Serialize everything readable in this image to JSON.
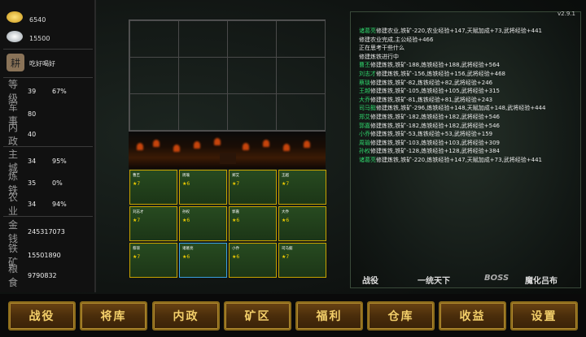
{
  "resources": {
    "gold": "6540",
    "silver": "15500"
  },
  "status": "吃好喝好",
  "stats": [
    {
      "key": "等级",
      "value": "39",
      "pct": "67%"
    },
    {
      "key": "军事",
      "value": "80",
      "pct": ""
    },
    {
      "key": "内政",
      "value": "40",
      "pct": ""
    },
    {
      "key": "主城",
      "value": "34",
      "pct": "95%"
    },
    {
      "key": "炼铁",
      "value": "35",
      "pct": "0%"
    },
    {
      "key": "农业",
      "value": "34",
      "pct": "94%"
    },
    {
      "key": "金钱",
      "value": "245317073",
      "pct": ""
    },
    {
      "key": "铁矿",
      "value": "15501890",
      "pct": ""
    },
    {
      "key": "粮食",
      "value": "9790832",
      "pct": ""
    }
  ],
  "version": "v2.9.1",
  "log": [
    {
      "name": "诸葛亮",
      "text": "修建农业,铁矿-220,农业经验+147,天赋加成+73,武将经验+441"
    },
    {
      "name": "",
      "text": "修建农业完成,主公经验+466"
    },
    {
      "name": "",
      "text": "正在思考干些什么"
    },
    {
      "name": "",
      "text": "修建炼铁进行中"
    },
    {
      "name": "曹丕",
      "text": "修建炼铁,铁矿-188,炼铁经验+188,武将经验+564"
    },
    {
      "name": "刘志才",
      "text": "修建炼铁,铁矿-156,炼铁经验+156,武将经验+468"
    },
    {
      "name": "蔡琰",
      "text": "修建炼铁,铁矿-82,炼铁经验+82,武将经验+246"
    },
    {
      "name": "王越",
      "text": "修建炼铁,铁矿-105,炼铁经验+105,武将经验+315"
    },
    {
      "name": "大乔",
      "text": "修建炼铁,铁矿-81,炼铁经验+81,武将经验+243"
    },
    {
      "name": "司马懿",
      "text": "修建炼铁,铁矿-296,炼铁经验+148,天赋加成+148,武将经验+444"
    },
    {
      "name": "郑艾",
      "text": "修建炼铁,铁矿-182,炼铁经验+182,武将经验+546"
    },
    {
      "name": "郭嘉",
      "text": "修建炼铁,铁矿-182,炼铁经验+182,武将经验+546"
    },
    {
      "name": "小乔",
      "text": "修建炼铁,铁矿-53,炼铁经验+53,武将经验+159"
    },
    {
      "name": "周瑜",
      "text": "修建炼铁,铁矿-103,炼铁经验+103,武将经验+309"
    },
    {
      "name": "孙权",
      "text": "修建炼铁,铁矿-128,炼铁经验+128,武将经验+384"
    },
    {
      "name": "诸葛亮",
      "text": "修建炼铁,铁矿-220,炼铁经验+147,天赋加成+73,武将经验+441"
    }
  ],
  "log_tabs": [
    "战役",
    "一统天下",
    "BOSS",
    "魔化吕布"
  ],
  "nav": [
    "战役",
    "将库",
    "内政",
    "矿区",
    "福利",
    "仓库",
    "收益",
    "设置"
  ],
  "heroes": [
    {
      "name": "曹丕",
      "star": "★7"
    },
    {
      "name": "周瑜",
      "star": "★6"
    },
    {
      "name": "郑艾",
      "star": "★7"
    },
    {
      "name": "王越",
      "star": "★7"
    },
    {
      "name": "刘志才",
      "star": "★7"
    },
    {
      "name": "孙权",
      "star": "★6"
    },
    {
      "name": "郭嘉",
      "star": "★6"
    },
    {
      "name": "大乔",
      "star": "★6"
    },
    {
      "name": "蔡琰",
      "star": "★7"
    },
    {
      "name": "诸葛亮",
      "star": "★6"
    },
    {
      "name": "小乔",
      "star": "★6"
    },
    {
      "name": "司马懿",
      "star": "★7"
    }
  ]
}
